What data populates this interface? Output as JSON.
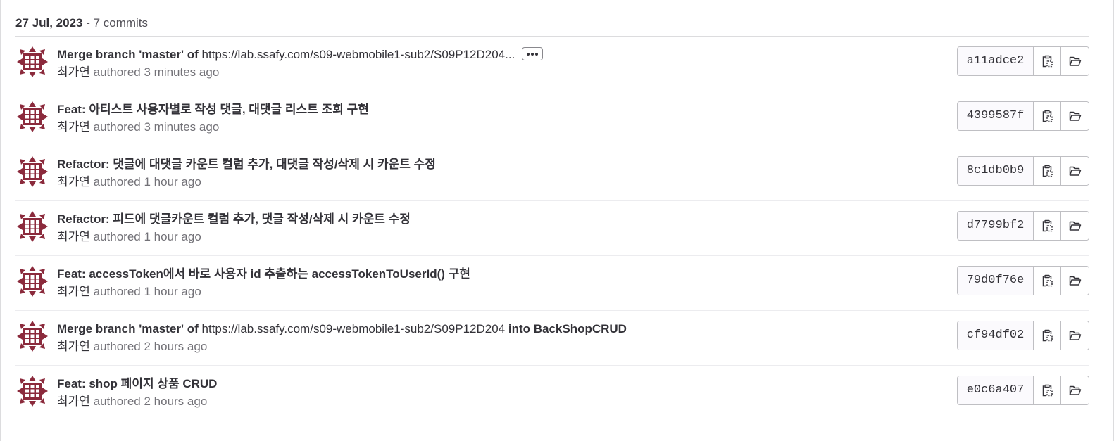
{
  "header": {
    "date": "27 Jul, 2023",
    "count": " - 7 commits"
  },
  "colors": {
    "avatar": "#8b2a3c",
    "text": "#333238",
    "muted": "#737278",
    "border": "#dcdcde"
  },
  "commits": [
    {
      "title_prefix": "Merge branch 'master' of ",
      "title_url": "https://lab.ssafy.com/s09-webmobile1-sub2/S09P12D204...",
      "has_more": true,
      "author": "최가연",
      "authored": " authored 3 minutes ago",
      "sha": "a11adce2"
    },
    {
      "title": "Feat: 아티스트 사용자별로 작성 댓글, 대댓글 리스트 조회 구현",
      "author": "최가연",
      "authored": " authored 3 minutes ago",
      "sha": "4399587f"
    },
    {
      "title": "Refactor: 댓글에 대댓글 카운트 컬럼 추가, 대댓글 작성/삭제 시 카운트 수정",
      "author": "최가연",
      "authored": " authored 1 hour ago",
      "sha": "8c1db0b9"
    },
    {
      "title": "Refactor: 피드에 댓글카운트 컬럼 추가, 댓글 작성/삭제 시 카운트 수정",
      "author": "최가연",
      "authored": " authored 1 hour ago",
      "sha": "d7799bf2"
    },
    {
      "title": "Feat: accessToken에서 바로 사용자 id 추출하는 accessTokenToUserId() 구현",
      "author": "최가연",
      "authored": " authored 1 hour ago",
      "sha": "79d0f76e"
    },
    {
      "title_prefix": "Merge branch 'master' of ",
      "title_url": "https://lab.ssafy.com/s09-webmobile1-sub2/S09P12D204",
      "title_suffix": " into BackShopCRUD",
      "author": "최가연",
      "authored": " authored 2 hours ago",
      "sha": "cf94df02"
    },
    {
      "title": "Feat: shop 페이지 상품 CRUD",
      "author": "최가연",
      "authored": " authored 2 hours ago",
      "sha": "e0c6a407"
    }
  ],
  "icons": {
    "avatar": "identicon-avatar",
    "copy": "copy-to-clipboard-icon",
    "browse": "folder-open-icon",
    "more": "ellipsis-icon"
  }
}
